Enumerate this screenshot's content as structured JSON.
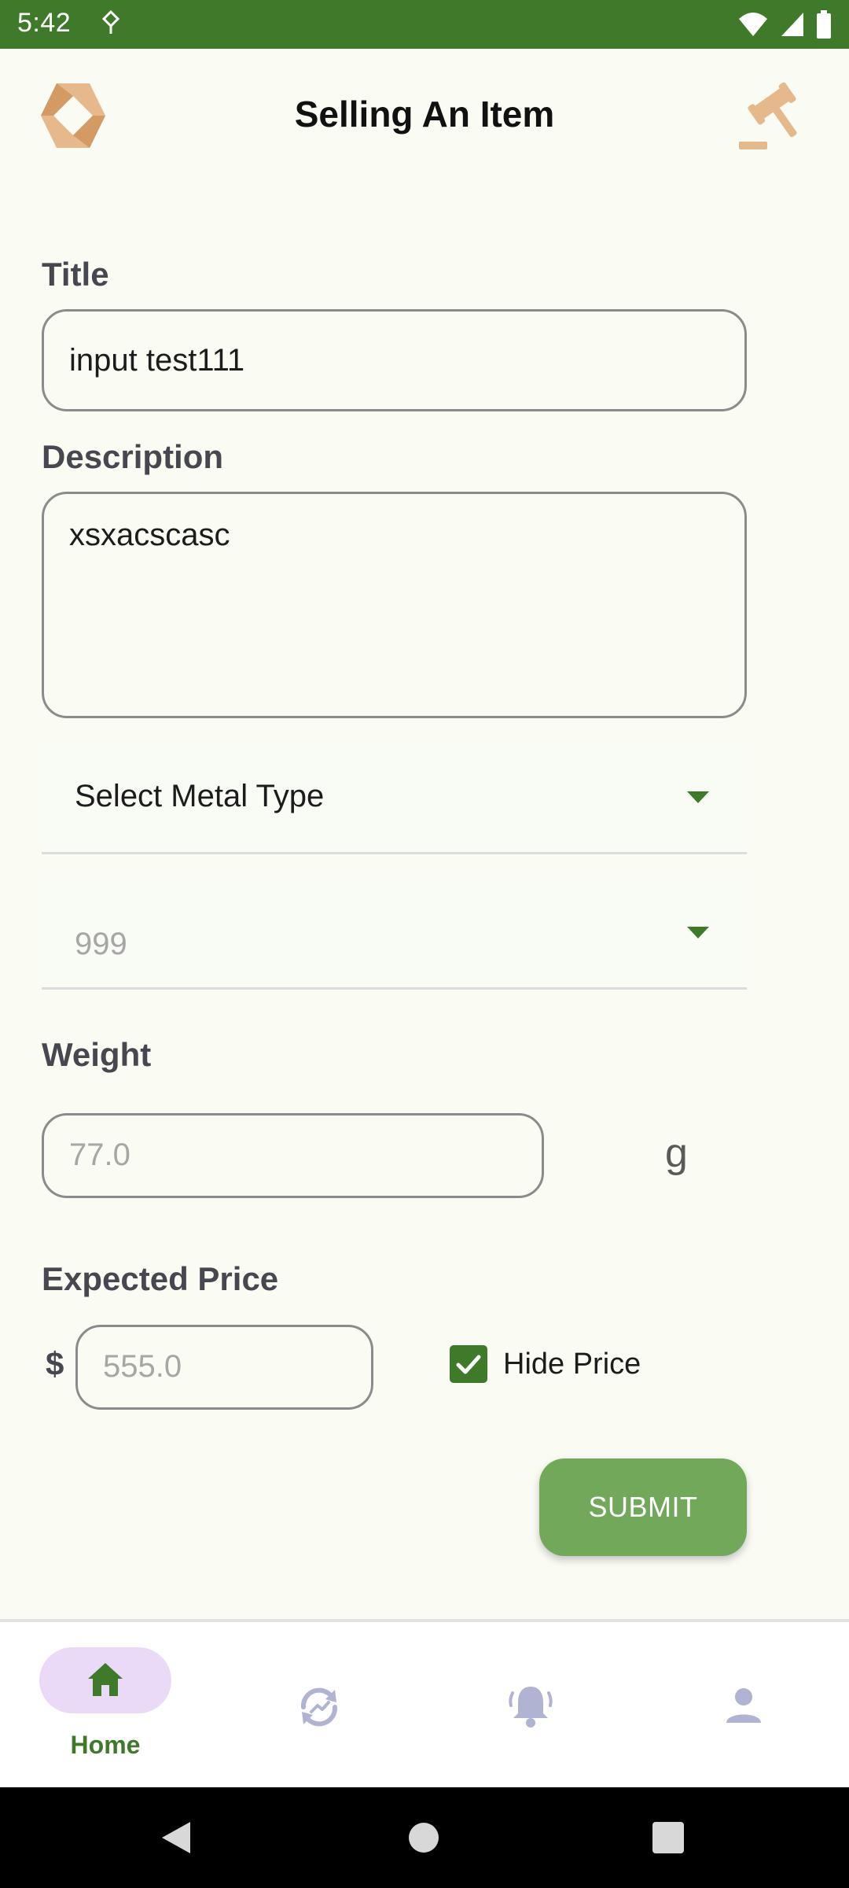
{
  "status_bar": {
    "time": "5:42"
  },
  "header": {
    "title": "Selling An Item"
  },
  "form": {
    "title_label": "Title",
    "title_value": "input test111",
    "description_label": "Description",
    "description_value": "xsxacscasc",
    "metal_type_select": "Select Metal Type",
    "purity_select": "999",
    "weight_label": "Weight",
    "weight_placeholder": "77.0",
    "weight_unit": "g",
    "price_label": "Expected Price",
    "currency_symbol": "$",
    "price_placeholder": "555.0",
    "hide_price_label": "Hide Price",
    "hide_price_checked": true,
    "submit_label": "SUBMIT"
  },
  "bottom_nav": {
    "items": [
      {
        "label": "Home",
        "icon": "home-icon",
        "active": true
      },
      {
        "label": "",
        "icon": "chart-refresh-icon",
        "active": false
      },
      {
        "label": "",
        "icon": "bell-icon",
        "active": false
      },
      {
        "label": "",
        "icon": "person-icon",
        "active": false
      }
    ]
  },
  "colors": {
    "primary_green": "#3f7a2b",
    "button_green": "#72a85a",
    "accent_tan": "#e6b98c",
    "nav_icon_inactive": "#b0b3d2",
    "nav_pill": "#ead9f7"
  }
}
